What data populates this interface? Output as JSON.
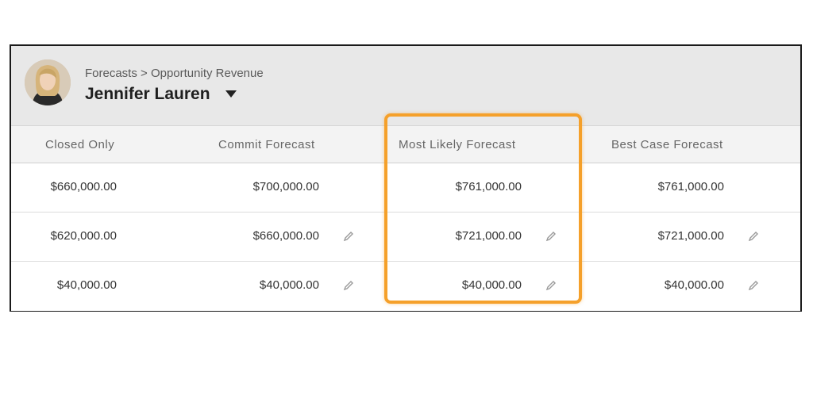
{
  "header": {
    "breadcrumb": "Forecasts > Opportunity Revenue",
    "user_name": "Jennifer Lauren",
    "dropdown_icon": "caret-down-icon"
  },
  "columns": [
    "Closed Only",
    "Commit Forecast",
    "Most Likely Forecast",
    "Best Case Forecast"
  ],
  "rows": [
    {
      "closed_only": "$660,000.00",
      "commit": "$700,000.00",
      "most_likely": "$761,000.00",
      "best_case": "$761,000.00",
      "editable": false
    },
    {
      "closed_only": "$620,000.00",
      "commit": "$660,000.00",
      "most_likely": "$721,000.00",
      "best_case": "$721,000.00",
      "editable": true
    },
    {
      "closed_only": "$40,000.00",
      "commit": "$40,000.00",
      "most_likely": "$40,000.00",
      "best_case": "$40,000.00",
      "editable": true
    }
  ],
  "colors": {
    "highlight": "#f5a02a",
    "header_bg": "#e8e8e8",
    "column_header_bg": "#f3f3f3"
  },
  "icons": {
    "edit": "pencil-icon"
  }
}
